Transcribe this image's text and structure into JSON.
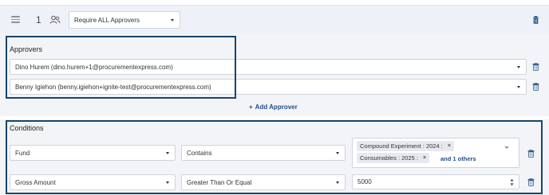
{
  "step": {
    "number": "1",
    "approval_mode": "Require ALL Approvers"
  },
  "approvers": {
    "title": "Approvers",
    "items": [
      {
        "label": "Dino Hurem (dino.hurem+1@procurementexpress.com)"
      },
      {
        "label": "Benny Igiehon (benny.igiehon+ignite-test@procurementexpress.com)"
      }
    ],
    "add_label": "Add Approver"
  },
  "conditions": {
    "title": "Conditions",
    "rows": [
      {
        "field": "Fund",
        "operator": "Contains",
        "values": [
          "Compound Experiment : 2024 :",
          "Consumables : 2025 :"
        ],
        "more": "and 1 others"
      },
      {
        "field": "Gross Amount",
        "operator": "Greater Than Or Equal",
        "amount": "5000"
      }
    ]
  },
  "icons": {
    "drag": "drag-handle-icon",
    "group": "users-icon",
    "delete": "trash-icon",
    "add": "plus-icon",
    "remove_chip": "close-icon"
  },
  "colors": {
    "accent": "#1f4e8a",
    "highlight_border": "#16466b",
    "panel_bg": "#f3f4f7",
    "header_bg": "#eef1f7"
  }
}
